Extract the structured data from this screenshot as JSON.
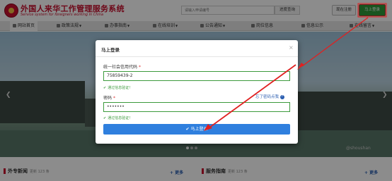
{
  "header": {
    "site_title": "外国人来华工作管理服务系统",
    "site_subtitle": "Service system for foreigners working in China",
    "search_placeholder": "请输入申请编号",
    "search_button": "进度查询",
    "register_button": "现在注册",
    "login_button": "马上登录"
  },
  "nav": {
    "items": [
      {
        "label": "网站首页"
      },
      {
        "label": "政策法规"
      },
      {
        "label": "办事指南"
      },
      {
        "label": "在线培训"
      },
      {
        "label": "公告通知"
      },
      {
        "label": "岗位信息"
      },
      {
        "label": "信息公示"
      },
      {
        "label": "在线留言"
      }
    ]
  },
  "banner": {
    "watermark": "@shoushan"
  },
  "sections": [
    {
      "title": "外专新闻",
      "updated": "更新 123 条",
      "more": "更多"
    },
    {
      "title": "服务指南",
      "updated": "更新 123 条",
      "more": "更多"
    }
  ],
  "modal": {
    "title": "马上登录",
    "close": "×",
    "credit_code_label": "统一社会信用代码",
    "credit_code_value": "75859439-2",
    "credit_code_valid": "通过信息验证！",
    "password_label": "密码",
    "password_value": "•••••••",
    "password_valid": "通过信息验证！",
    "forgot_password": "忘了密码点我",
    "submit": "马上登录"
  },
  "colors": {
    "brand_red": "#c8102e",
    "login_green": "#2e9a3a",
    "primary_blue": "#2f7fde",
    "annotation_red": "#e02020",
    "valid_green": "#3c9a3c"
  }
}
